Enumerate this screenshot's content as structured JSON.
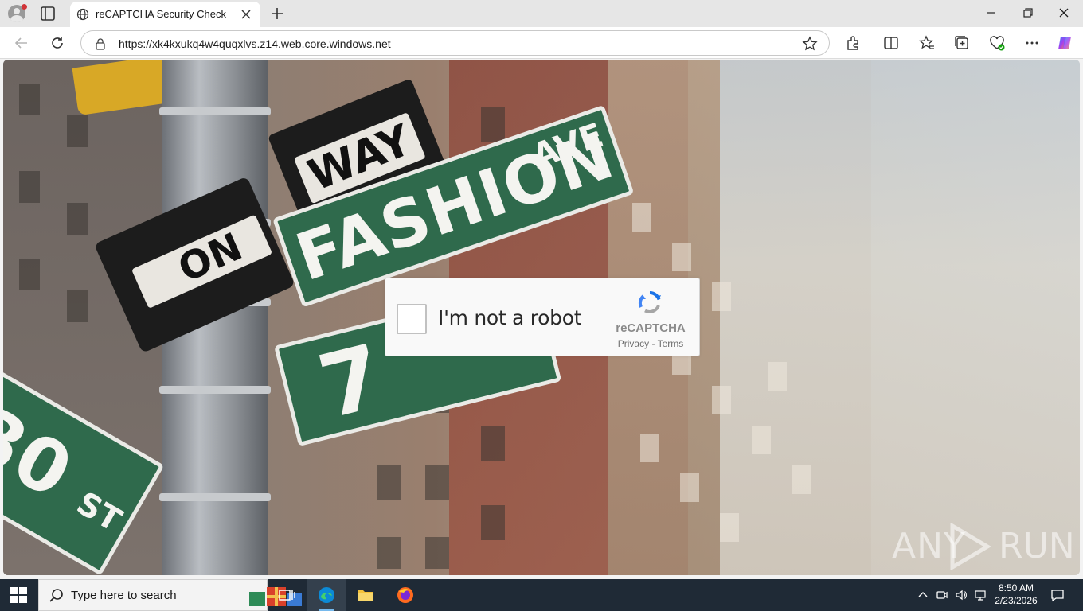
{
  "browser": {
    "tab": {
      "title": "reCAPTCHA Security Check",
      "icon": "globe-icon"
    },
    "address_bar": {
      "url": "https://xk4kxukq4w4quqxlvs.z14.web.core.windows.net"
    },
    "toolbar_icons": [
      "back-icon",
      "refresh-icon",
      "extensions-icon",
      "split-screen-icon",
      "favorites-icon",
      "collections-icon",
      "browser-essentials-icon",
      "more-icon",
      "copilot-icon"
    ]
  },
  "page": {
    "background_signs": {
      "way": "WAY",
      "one": "ON",
      "fashion": "FASHION",
      "ave": "AVE",
      "seven": "7",
      "thirty": "30",
      "st": "ST"
    },
    "captcha": {
      "checkbox_label": "I'm not a robot",
      "checked": false,
      "brand": "reCAPTCHA",
      "privacy": "Privacy",
      "separator": " - ",
      "terms": "Terms"
    },
    "watermark": {
      "left": "ANY",
      "right": "RUN"
    }
  },
  "taskbar": {
    "search_placeholder": "Type here to search",
    "time": "8:50 AM",
    "date": "2/23/2026"
  },
  "colors": {
    "street_sign_green": "#2f6a4c",
    "taskbar": "#1f2a36",
    "recaptcha_blue": "#1a73e8"
  }
}
